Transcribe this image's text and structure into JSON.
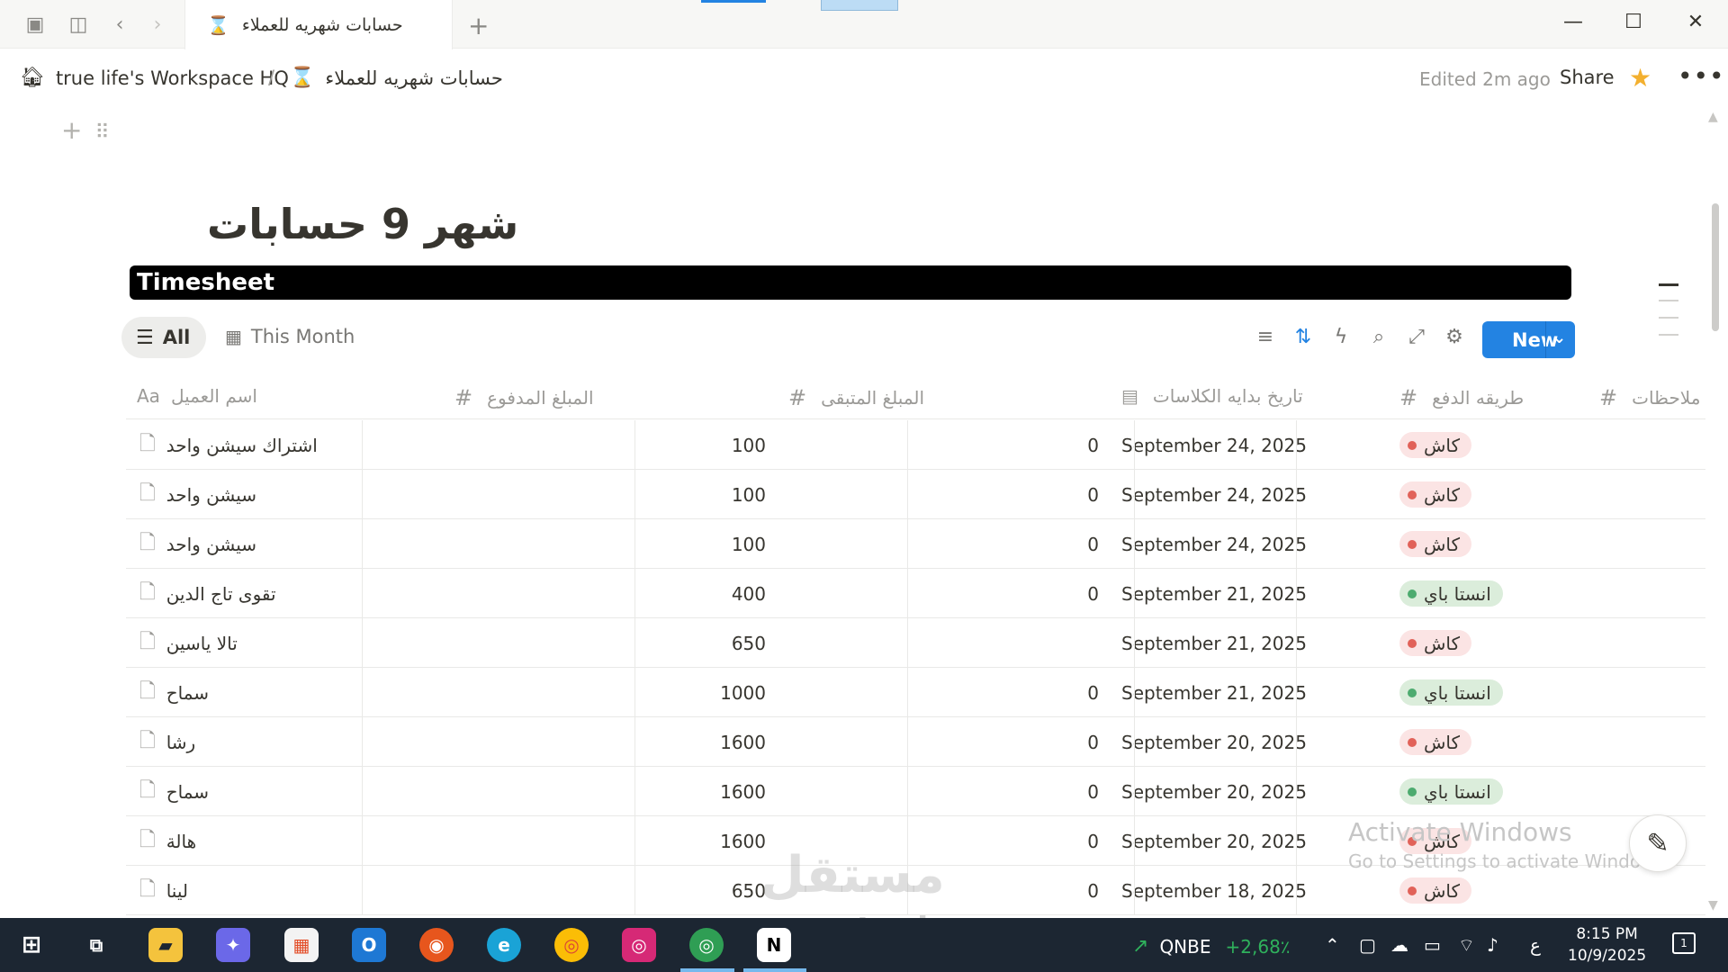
{
  "window": {
    "tab_title": "حسابات شهريه للعملاء",
    "tab_icon": "hourglass-icon"
  },
  "breadcrumb": {
    "workspace": "true life's Workspace HQ",
    "separator": "/",
    "page": "حسابات شهريه للعملاء"
  },
  "topbar": {
    "edited": "Edited 2m ago",
    "share": "Share",
    "more": "•••"
  },
  "page": {
    "title": "شهر 9 حسابات",
    "banner": "Timesheet"
  },
  "views": {
    "all": "All",
    "this_month": "This Month",
    "new_button": "New"
  },
  "table": {
    "columns": {
      "name": "اسم العميل",
      "name_icon": "Aa",
      "paid": "المبلغ المدفوع",
      "remaining": "المبلغ المتبقى",
      "start_date": "تاريخ بدايه الكلاسات",
      "payment": "طريقه الدفع",
      "notes": "ملاحظات",
      "number_icon": "#"
    },
    "rows": [
      {
        "name": "اشتراك سيشن واحد",
        "paid": "100",
        "remaining": "0",
        "date": "September 24, 2025",
        "payment": "كاش",
        "pay_color": "#fbe4e4",
        "dot": "#e16259"
      },
      {
        "name": "سيشن واحد",
        "paid": "100",
        "remaining": "0",
        "date": "September 24, 2025",
        "payment": "كاش",
        "pay_color": "#fbe4e4",
        "dot": "#e16259"
      },
      {
        "name": "سيشن واحد",
        "paid": "100",
        "remaining": "0",
        "date": "September 24, 2025",
        "payment": "كاش",
        "pay_color": "#fbe4e4",
        "dot": "#e16259"
      },
      {
        "name": "تقوى تاج الدين",
        "paid": "400",
        "remaining": "0",
        "date": "September 21, 2025",
        "payment": "انستا باي",
        "pay_color": "#dbeddb",
        "dot": "#4dab6f"
      },
      {
        "name": "تالا ياسين",
        "paid": "650",
        "remaining": "",
        "date": "September 21, 2025",
        "payment": "كاش",
        "pay_color": "#fbe4e4",
        "dot": "#e16259"
      },
      {
        "name": "سماح",
        "paid": "1000",
        "remaining": "0",
        "date": "September 21, 2025",
        "payment": "انستا باي",
        "pay_color": "#dbeddb",
        "dot": "#4dab6f"
      },
      {
        "name": "رشا",
        "paid": "1600",
        "remaining": "0",
        "date": "September 20, 2025",
        "payment": "كاش",
        "pay_color": "#fbe4e4",
        "dot": "#e16259"
      },
      {
        "name": "سماح",
        "paid": "1600",
        "remaining": "0",
        "date": "September 20, 2025",
        "payment": "انستا باي",
        "pay_color": "#dbeddb",
        "dot": "#4dab6f"
      },
      {
        "name": "هالة",
        "paid": "1600",
        "remaining": "0",
        "date": "September 20, 2025",
        "payment": "كاش",
        "pay_color": "#fbe4e4",
        "dot": "#e16259"
      },
      {
        "name": "لينا",
        "paid": "650",
        "remaining": "0",
        "date": "September 18, 2025",
        "payment": "كاش",
        "pay_color": "#fbe4e4",
        "dot": "#e16259"
      }
    ]
  },
  "overlay": {
    "activate_title": "Activate Windows",
    "activate_sub": "Go to Settings to activate Windows.",
    "brand_ar": "مستقل",
    "brand_en": "mostaql.com"
  },
  "taskbar": {
    "ticker_name": "QNBE",
    "ticker_change": "+2,68٪",
    "lang": "ع",
    "time": "8:15 PM",
    "date": "10/9/2025",
    "notifications": "1"
  }
}
